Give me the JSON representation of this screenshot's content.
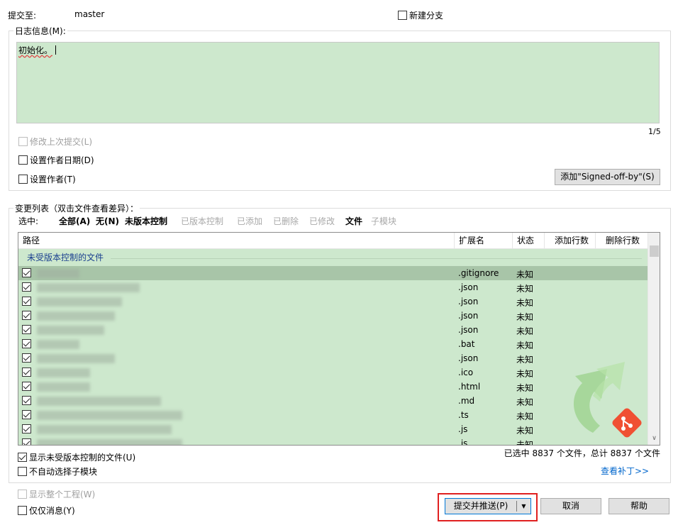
{
  "commit_to": {
    "label": "提交至:",
    "branch": "master",
    "new_branch_label": "新建分支",
    "new_branch_checked": false
  },
  "message": {
    "group_label": "日志信息(M):",
    "text": "初始化。",
    "counter": "1/5",
    "amend_label": "修改上次提交(L)",
    "set_author_date_label": "设置作者日期(D)",
    "set_author_label": "设置作者(T)",
    "signoff_button": "添加\"Signed-off-by\"(S)"
  },
  "changes": {
    "group_label": "变更列表（双击文件查看差异）：",
    "filter_prefix": "选中:",
    "filters": [
      {
        "label": "全部(A)",
        "style": "bold"
      },
      {
        "label": "无(N)",
        "style": "bold"
      },
      {
        "label": "未版本控制",
        "style": "bold"
      },
      {
        "label": "已版本控制",
        "style": "gray"
      },
      {
        "label": "已添加",
        "style": "gray"
      },
      {
        "label": "已删除",
        "style": "gray"
      },
      {
        "label": "已修改",
        "style": "gray"
      },
      {
        "label": "文件",
        "style": "bold"
      },
      {
        "label": "子模块",
        "style": "gray"
      }
    ],
    "columns": [
      "路径",
      "扩展名",
      "状态",
      "添加行数",
      "删除行数"
    ],
    "group_row": "未受版本控制的文件",
    "rows": [
      {
        "ext": ".gitignore",
        "status": "未知",
        "selected": true
      },
      {
        "ext": ".json",
        "status": "未知"
      },
      {
        "ext": ".json",
        "status": "未知"
      },
      {
        "ext": ".json",
        "status": "未知"
      },
      {
        "ext": ".json",
        "status": "未知"
      },
      {
        "ext": ".bat",
        "status": "未知"
      },
      {
        "ext": ".json",
        "status": "未知"
      },
      {
        "ext": ".ico",
        "status": "未知"
      },
      {
        "ext": ".html",
        "status": "未知"
      },
      {
        "ext": ".md",
        "status": "未知"
      },
      {
        "ext": ".ts",
        "status": "未知"
      },
      {
        "ext": ".js",
        "status": "未知"
      },
      {
        "ext": ".js",
        "status": "未知"
      }
    ],
    "summary": "已选中 8837 个文件，总计 8837 个文件",
    "show_unversioned_label": "显示未受版本控制的文件(U)",
    "no_auto_submodule_label": "不自动选择子模块",
    "view_patch_link": "查看补丁>>"
  },
  "footer": {
    "show_whole_project_label": "显示整个工程(W)",
    "message_only_label": "仅仅消息(Y)",
    "commit_push_button": "提交并推送(P)",
    "cancel_button": "取消",
    "help_button": "帮助"
  },
  "colors": {
    "list_bg": "#cde8cd",
    "selected_row": "#a8c5a8",
    "highlight_box": "#e02020",
    "link": "#0066cc"
  }
}
